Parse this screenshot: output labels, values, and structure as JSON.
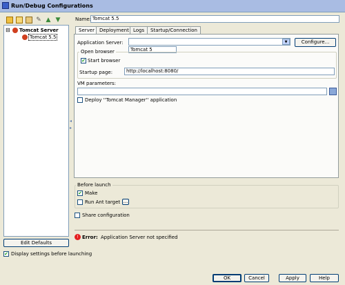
{
  "window": {
    "title": "Run/Debug Configurations"
  },
  "toolbar": {
    "icons": [
      "add-icon",
      "copy-icon",
      "folder-icon",
      "edit-icon",
      "move-up-icon",
      "move-down-icon"
    ]
  },
  "tree": {
    "root_label": "Tomcat Server",
    "root_toggle": "⊟",
    "child_label": "Tomcat 5.5"
  },
  "edit_defaults_label": "Edit Defaults",
  "display_settings_label": "Display settings before launching",
  "name": {
    "label": "Name:",
    "value": "Tomcat 5.5"
  },
  "tabs": [
    {
      "label": "Server"
    },
    {
      "label": "Deployment"
    },
    {
      "label": "Logs"
    },
    {
      "label": "Startup/Connection"
    }
  ],
  "server_tab": {
    "app_server_label": "Application Server:",
    "app_server_value": "",
    "dropdown_option": "Tomcat 5",
    "configure_label": "Configure...",
    "open_browser": {
      "title": "Open browser",
      "start_browser_label": "Start browser",
      "startup_page_label": "Startup page:",
      "startup_page_value": "http://localhost:8080/"
    },
    "vm_params_label": "VM parameters:",
    "vm_params_value": "",
    "deploy_label": "Deploy ''Tomcat Manager'' application"
  },
  "before_launch": {
    "title": "Before launch",
    "make_label": "Make",
    "run_ant_label": "Run Ant target",
    "ellipsis": "..."
  },
  "share_label": "Share configuration",
  "error": {
    "prefix": "Error:",
    "message": "Application Server not specified"
  },
  "buttons": {
    "ok": "OK",
    "cancel": "Cancel",
    "apply": "Apply",
    "help": "Help"
  },
  "colors": {
    "titlebar": "#a9bce3",
    "error": "#e52020",
    "check": "#21a121"
  }
}
